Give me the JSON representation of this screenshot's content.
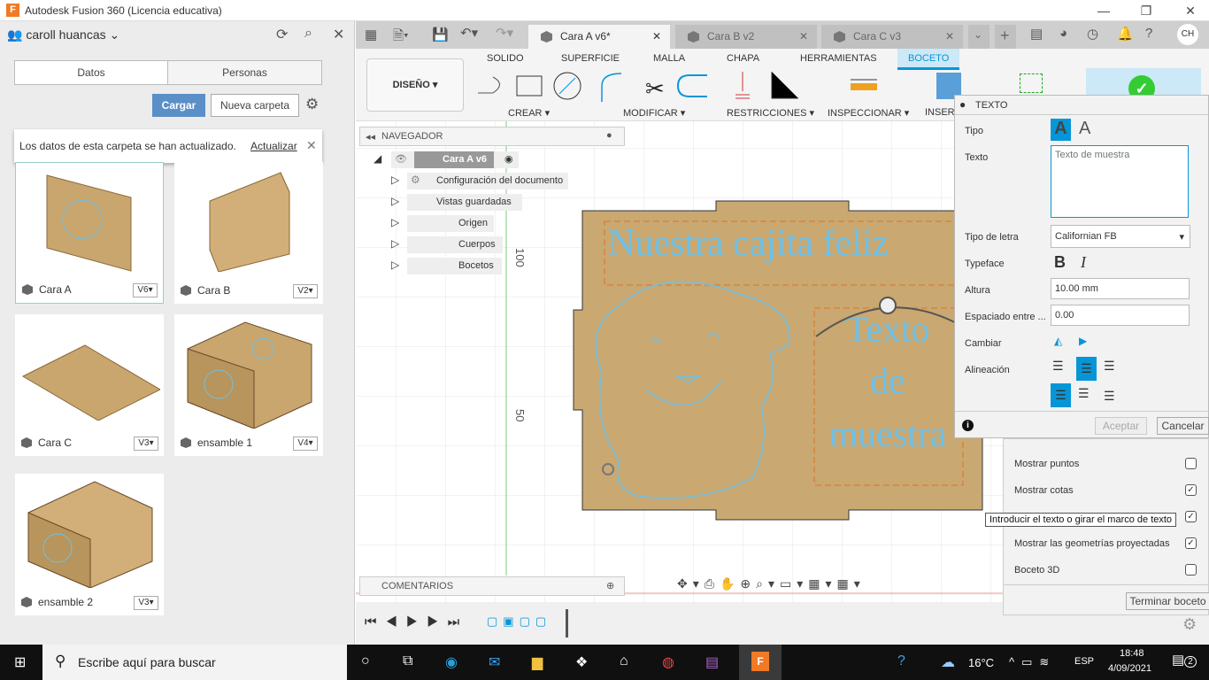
{
  "window": {
    "title": "Autodesk Fusion 360 (Licencia educativa)",
    "app_icon": "F"
  },
  "data_panel": {
    "user": "caroll huancas",
    "tabs": [
      "Datos",
      "Personas"
    ],
    "upload_label": "Cargar",
    "new_folder_label": "Nueva carpeta",
    "notice": {
      "text": "Los datos de esta carpeta se han actualizado.",
      "link": "Actualizar"
    },
    "items": [
      {
        "name": "Cara A",
        "version": "V6"
      },
      {
        "name": "Cara B",
        "version": "V2"
      },
      {
        "name": "Cara C",
        "version": "V3"
      },
      {
        "name": "ensamble 1",
        "version": "V4"
      },
      {
        "name": "ensamble 2",
        "version": "V3"
      }
    ]
  },
  "doc_tabs": [
    {
      "label": "Cara A v6*",
      "active": true
    },
    {
      "label": "Cara B v2",
      "active": false
    },
    {
      "label": "Cara C v3",
      "active": false
    }
  ],
  "user_initials": "CH",
  "ribbon": {
    "workspace": "DISEÑO",
    "tabs": [
      "SOLIDO",
      "SUPERFICIE",
      "MALLA",
      "CHAPA",
      "HERRAMIENTAS",
      "BOCETO"
    ],
    "active_tab": "BOCETO",
    "groups": [
      "CREAR",
      "MODIFICAR",
      "RESTRICCIONES",
      "INSPECCIONAR",
      "INSERT"
    ],
    "accent": "#0696d7"
  },
  "browser": {
    "title": "NAVEGADOR",
    "root": "Cara A v6",
    "nodes": [
      "Configuración del documento",
      "Vistas guardadas",
      "Origen",
      "Cuerpos",
      "Bocetos"
    ]
  },
  "comments_label": "COMENTARIOS",
  "canvas": {
    "ruler_labels": [
      "100",
      "50"
    ],
    "sketch_text_1": "Nuestra cajita feliz",
    "sketch_text_2": [
      "Texto",
      "de",
      "muestra"
    ],
    "sketch_color": "#6ec1e8"
  },
  "text_dialog": {
    "title": "TEXTO",
    "labels": {
      "type": "Tipo",
      "text": "Texto",
      "font": "Tipo de letra",
      "typeface": "Typeface",
      "height": "Altura",
      "spacing": "Espaciado entre ...",
      "flip": "Cambiar",
      "align": "Alineación"
    },
    "text_placeholder": "Texto de muestra",
    "font": "Californian FB",
    "height": "10.00 mm",
    "spacing": "0.00",
    "ok": "Aceptar",
    "cancel": "Cancelar"
  },
  "sketch_palette": {
    "options": [
      {
        "label": "Mostrar puntos",
        "checked": false
      },
      {
        "label": "Mostrar cotas",
        "checked": true
      },
      {
        "label": "",
        "checked": true
      },
      {
        "label": "Mostrar las geometrías proyectadas",
        "checked": true
      },
      {
        "label": "Boceto 3D",
        "checked": false
      }
    ],
    "finish": "Terminar boceto"
  },
  "tooltip": "Introducir el texto o girar el marco de texto",
  "taskbar": {
    "search": "Escribe aquí para buscar",
    "weather": "16°C",
    "lang": "ESP",
    "time": "18:48",
    "date": "4/09/2021",
    "notifications": "2"
  }
}
